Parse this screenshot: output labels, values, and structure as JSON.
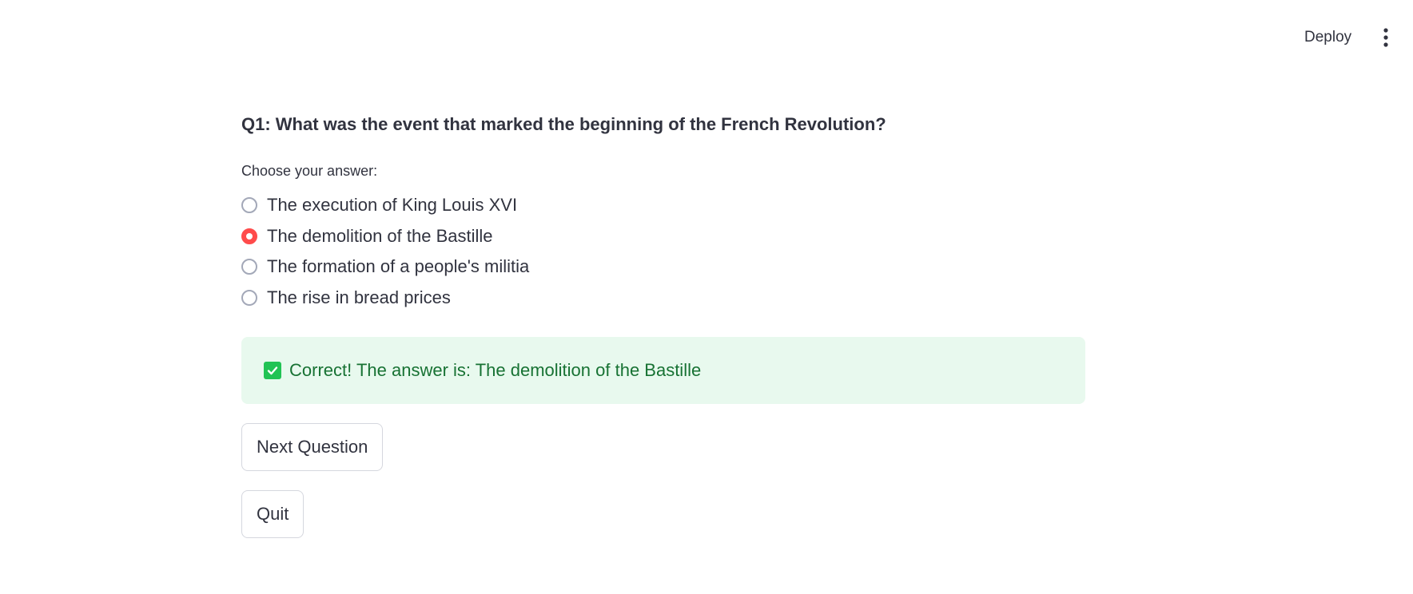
{
  "header": {
    "deploy_label": "Deploy",
    "menu_icon": "vertical-dots-icon"
  },
  "quiz": {
    "question": "Q1: What was the event that marked the beginning of the French Revolution?",
    "choose_label": "Choose your answer:",
    "options": [
      {
        "label": "The execution of King Louis XVI",
        "selected": false
      },
      {
        "label": "The demolition of the Bastille",
        "selected": true
      },
      {
        "label": "The formation of a people's militia",
        "selected": false
      },
      {
        "label": "The rise in bread prices",
        "selected": false
      }
    ],
    "result_message": "Correct! The answer is: The demolition of the Bastille",
    "result_icon": "check-box-icon",
    "next_button": "Next Question",
    "quit_button": "Quit"
  },
  "colors": {
    "accent": "#ff4b4b",
    "success_bg": "#e8f9ee",
    "success_text": "#177233",
    "success_icon": "#21c354",
    "text": "#31333f"
  }
}
